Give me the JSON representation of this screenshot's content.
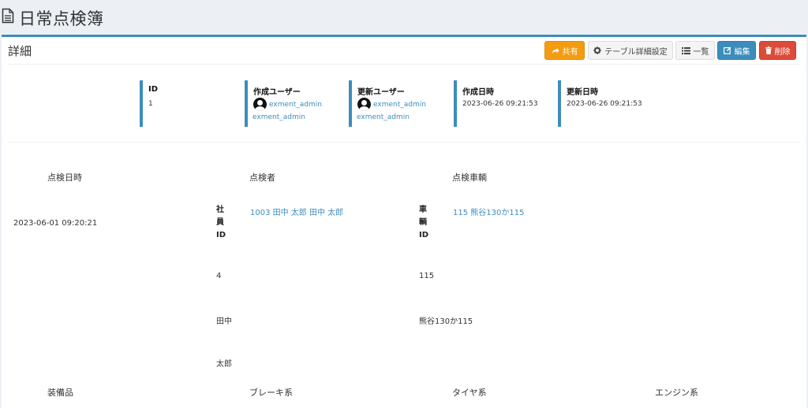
{
  "page": {
    "title": "日常点検簿",
    "icon": "document-icon"
  },
  "box": {
    "title": "詳細",
    "buttons": {
      "share": "共有",
      "table_settings": "テーブル詳細設定",
      "list": "一覧",
      "edit": "編集",
      "delete": "削除"
    }
  },
  "meta": {
    "id": {
      "label": "ID",
      "value": "1"
    },
    "created_user": {
      "label": "作成ユーザー",
      "user": "exment_admin",
      "user_sub": "exment_admin"
    },
    "updated_user": {
      "label": "更新ユーザー",
      "user": "exment_admin",
      "user_sub": "exment_admin"
    },
    "created_at": {
      "label": "作成日時",
      "value": "2023-06-26 09:21:53"
    },
    "updated_at": {
      "label": "更新日時",
      "value": "2023-06-26 09:21:53"
    }
  },
  "fields": {
    "inspection_datetime": {
      "label": "点検日時",
      "value": "2023-06-01 09:20:21"
    },
    "inspector": {
      "label": "点検者",
      "link": "1003 田中 太郎 田中 太郎",
      "sub_label": "社員ID",
      "sub_label_chars": [
        "社",
        "員",
        "ID"
      ],
      "employee_id": "4",
      "last_name": "田中",
      "first_name": "太郎"
    },
    "vehicle": {
      "label": "点検車輌",
      "link": "115 熊谷130か115",
      "sub_label": "車輌ID",
      "sub_label_chars": [
        "車",
        "輌",
        "ID"
      ],
      "vehicle_id": "115",
      "plate": "熊谷130か115"
    },
    "equipment": {
      "label": "装備品"
    },
    "brake": {
      "label": "ブレーキ系"
    },
    "tire": {
      "label": "タイヤ系"
    },
    "engine": {
      "label": "エンジン系"
    }
  },
  "colors": {
    "accent": "#3c8dbc",
    "share": "#f39c12",
    "delete": "#dd4b39",
    "background": "#ecf0f5"
  }
}
